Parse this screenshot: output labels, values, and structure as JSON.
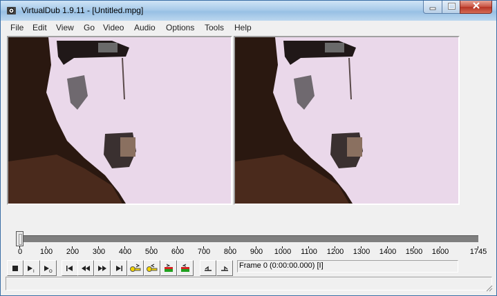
{
  "window": {
    "title": "VirtualDub 1.9.11 - [Untitled.mpg]"
  },
  "menu": [
    "File",
    "Edit",
    "View",
    "Go",
    "Video",
    "Audio",
    "Options",
    "Tools",
    "Help"
  ],
  "timeline": {
    "ticks": [
      "0",
      "100",
      "200",
      "300",
      "400",
      "500",
      "600",
      "700",
      "800",
      "900",
      "1000",
      "1100",
      "1200",
      "1300",
      "1400",
      "1500",
      "1600",
      "1745"
    ],
    "current_frame": 0
  },
  "status": {
    "frame_text": "Frame 0 (0:00:00.000) [I]"
  },
  "toolbar": {
    "buttons": [
      "stop-icon",
      "play-input-icon",
      "play-output-icon",
      "go-to-start-icon",
      "step-back-icon",
      "step-forward-icon",
      "go-to-end-icon",
      "prev-keyframe-icon",
      "next-keyframe-icon",
      "prev-scene-icon",
      "next-scene-icon",
      "mark-in-icon",
      "mark-out-icon"
    ]
  },
  "colors": {
    "title_gradient": "#a9cbea",
    "close_button": "#c7503f",
    "snow": "#ead8ea",
    "trees": "#2a1810"
  }
}
